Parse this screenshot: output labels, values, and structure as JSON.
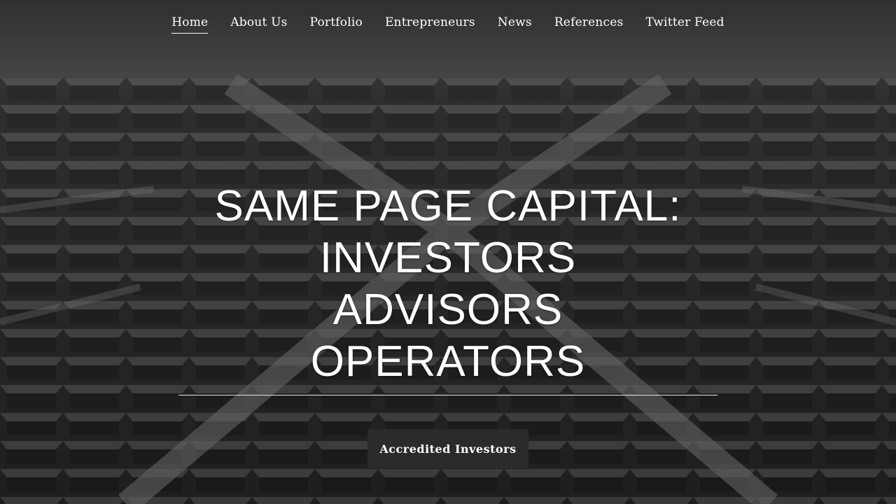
{
  "nav": {
    "items": [
      {
        "label": "Home",
        "active": true
      },
      {
        "label": "About Us"
      },
      {
        "label": "Portfolio"
      },
      {
        "label": "Entrepreneurs"
      },
      {
        "label": "News"
      },
      {
        "label": "References"
      },
      {
        "label": "Twitter Feed"
      }
    ]
  },
  "hero": {
    "headline_lines": [
      "SAME PAGE CAPITAL:",
      "INVESTORS",
      "ADVISORS",
      "OPERATORS"
    ],
    "cta_label": "Accredited Investors",
    "background": "grayscale-brutalist-building-photo"
  },
  "colors": {
    "text": "#ffffff",
    "button_bg": "#2b2b2b"
  }
}
